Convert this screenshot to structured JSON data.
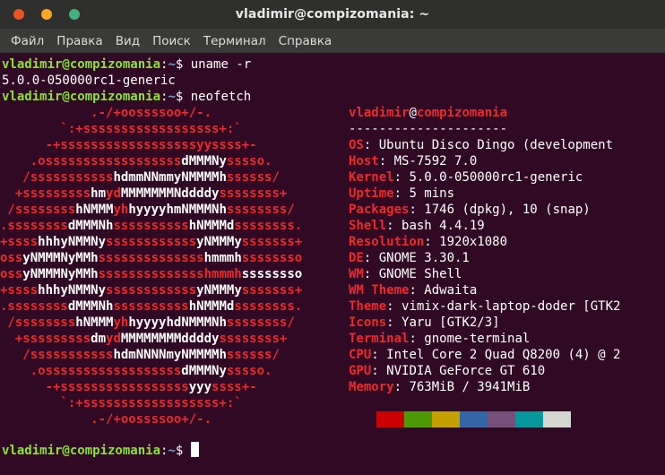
{
  "window": {
    "title": "vladimir@compizomania: ~"
  },
  "menu": [
    "Файл",
    "Правка",
    "Вид",
    "Поиск",
    "Терминал",
    "Справка"
  ],
  "prompt": {
    "user": "vladimir@compizomania",
    "sep": ":",
    "path": "~",
    "symbol": "$"
  },
  "commands": [
    {
      "cmd": " uname -r",
      "output": "5.0.0-050000rc1-generic"
    },
    {
      "cmd": " neofetch"
    }
  ],
  "logo": [
    [
      "            .-/+oossssoo+/-.",
      ""
    ],
    [
      "        `:+ssssssssssssssssss+:`",
      ""
    ],
    [
      "      -+ssssssssssssssssssyyssss+-",
      ""
    ],
    [
      "    .ossssssssssssssssss",
      "dMMMNy",
      "sssso."
    ],
    [
      "   /sssssssssss",
      "hdmmNNmmyNMMMMh",
      "ssssss/"
    ],
    [
      "  +sssssssss",
      "hm",
      "yd",
      "MMMMMMMNddddy",
      "ssssssss+"
    ],
    [
      " /ssssssss",
      "hNMMM",
      "yh",
      "hyyyyhmNMMMNh",
      "ssssssss/"
    ],
    [
      ".ssssssss",
      "dMMMNh",
      "ssssssssss",
      "hNMMMd",
      "ssssssss."
    ],
    [
      "+ssss",
      "hhhyNMMNy",
      "ssssssssssss",
      "yNMMMy",
      "sssssss+"
    ],
    [
      "oss",
      "yNMMMNyMMh",
      "ssssssssssssss",
      "hmmmh",
      "ssssssso"
    ],
    [
      "oss",
      "yNMMMNyMMh",
      "sssssssssssssshmmmh",
      "ssssssso"
    ],
    [
      "+ssss",
      "hhhyNMMNy",
      "ssssssssssss",
      "yNMMMy",
      "sssssss+"
    ],
    [
      ".ssssssss",
      "dMMMNh",
      "ssssssssss",
      "hNMMMd",
      "ssssssss."
    ],
    [
      " /ssssssss",
      "hNMMM",
      "yh",
      "hyyyyhdNMMMNh",
      "ssssssss/"
    ],
    [
      "  +sssssssss",
      "dm",
      "yd",
      "MMMMMMMMddddy",
      "ssssssss+"
    ],
    [
      "   /sssssssssss",
      "hdmNNNNmyNMMMMh",
      "ssssss/"
    ],
    [
      "    .ossssssssssssssssss",
      "dMMMNy",
      "sssso."
    ],
    [
      "      -+sssssssssssssssss",
      "yyy",
      "ssss+-"
    ],
    [
      "        `:+ssssssssssssssssss+:`",
      ""
    ],
    [
      "            .-/+oossssoo+/-.",
      ""
    ]
  ],
  "info": {
    "user": "vladimir",
    "at": "@",
    "host": "compizomania",
    "dashes": "---------------------",
    "rows": [
      {
        "key": "OS",
        "value": "Ubuntu Disco Dingo (development"
      },
      {
        "key": "Host",
        "value": "MS-7592 7.0"
      },
      {
        "key": "Kernel",
        "value": "5.0.0-050000rc1-generic"
      },
      {
        "key": "Uptime",
        "value": "5 mins"
      },
      {
        "key": "Packages",
        "value": "1746 (dpkg), 10 (snap)"
      },
      {
        "key": "Shell",
        "value": "bash 4.4.19"
      },
      {
        "key": "Resolution",
        "value": "1920x1080"
      },
      {
        "key": "DE",
        "value": "GNOME 3.30.1"
      },
      {
        "key": "WM",
        "value": "GNOME Shell"
      },
      {
        "key": "WM Theme",
        "value": "Adwaita"
      },
      {
        "key": "Theme",
        "value": "vimix-dark-laptop-doder [GTK2"
      },
      {
        "key": "Icons",
        "value": "Yaru [GTK2/3]"
      },
      {
        "key": "Terminal",
        "value": "gnome-terminal"
      },
      {
        "key": "CPU",
        "value": "Intel Core 2 Quad Q8200 (4) @ 2"
      },
      {
        "key": "GPU",
        "value": "NVIDIA GeForce GT 610"
      },
      {
        "key": "Memory",
        "value": "763MiB / 3941MiB"
      }
    ]
  },
  "palette": [
    "#300a24",
    "#cc0000",
    "#4e9a06",
    "#c4a000",
    "#3465a4",
    "#75507b",
    "#06989a",
    "#d3d7cf"
  ]
}
